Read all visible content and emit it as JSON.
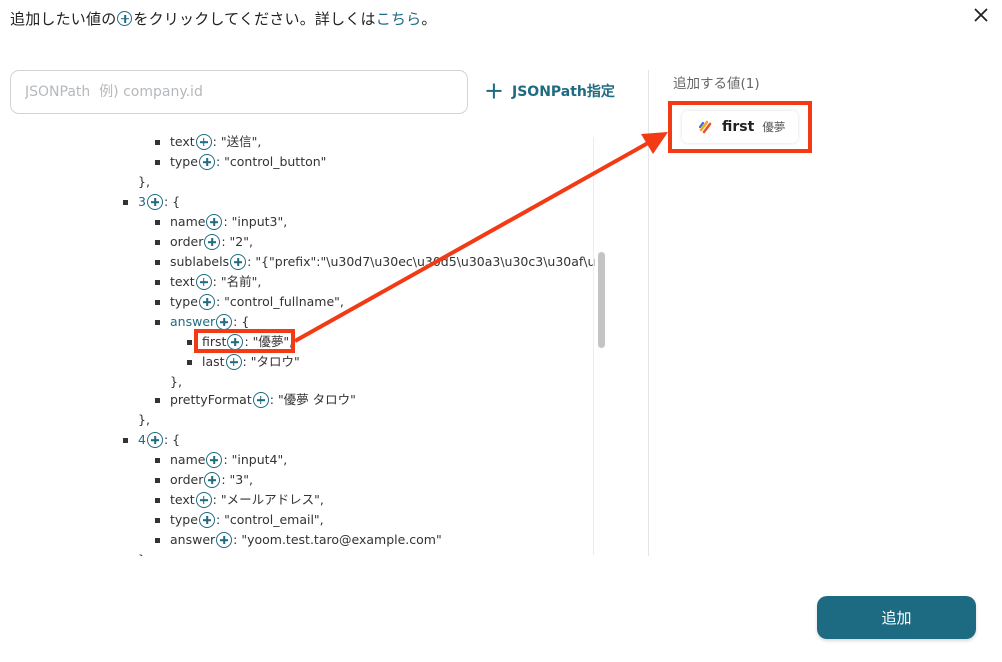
{
  "header": {
    "text_before": "追加したい値の",
    "text_after": "をクリックしてください。詳しくは",
    "link": "こちら",
    "period": "。"
  },
  "search": {
    "placeholder": "JSONPath  例) company.id",
    "value": ""
  },
  "jsonpath_button": {
    "label": "JSONPath指定"
  },
  "tree": [
    {
      "key": "text",
      "sep": ": ",
      "value": "\"送信\","
    },
    {
      "key": "type",
      "sep": ": ",
      "value": "\"control_button\""
    },
    {
      "key": "",
      "sep": "",
      "value": "},"
    },
    {
      "key": "3",
      "sep": ": ",
      "value": "{"
    },
    {
      "key": "name",
      "sep": ": ",
      "value": "\"input3\","
    },
    {
      "key": "order",
      "sep": ": ",
      "value": "\"2\","
    },
    {
      "key": "sublabels",
      "sep": ": ",
      "value": "\"{\"prefix\":\"\\u30d7\\u30ec\\u30d5\\u30a3\\u30c3\\u30af\\u"
    },
    {
      "key": "text",
      "sep": ": ",
      "value": "\"名前\","
    },
    {
      "key": "type",
      "sep": ": ",
      "value": "\"control_fullname\","
    },
    {
      "key": "answer",
      "sep": ": ",
      "value": "{"
    },
    {
      "key": "first",
      "sep": ": ",
      "value": "\"優夢\","
    },
    {
      "key": "last",
      "sep": ": ",
      "value": "\"タロウ\""
    },
    {
      "key": "",
      "sep": "",
      "value": "},"
    },
    {
      "key": "prettyFormat",
      "sep": ": ",
      "value": "\"優夢 タロウ\""
    },
    {
      "key": "",
      "sep": "",
      "value": "},"
    },
    {
      "key": "4",
      "sep": ": ",
      "value": "{"
    },
    {
      "key": "name",
      "sep": ": ",
      "value": "\"input4\","
    },
    {
      "key": "order",
      "sep": ": ",
      "value": "\"3\","
    },
    {
      "key": "text",
      "sep": ": ",
      "value": "\"メールアドレス\","
    },
    {
      "key": "type",
      "sep": ": ",
      "value": "\"control_email\","
    },
    {
      "key": "answer",
      "sep": ": ",
      "value": "\"yoom.test.taro@example.com\""
    },
    {
      "key": "",
      "sep": "",
      "value": "}"
    }
  ],
  "right_panel": {
    "title": "追加する値(1)",
    "values": [
      {
        "key": "first",
        "value": "優夢"
      }
    ]
  },
  "add_button": {
    "label": "追加"
  },
  "colors": {
    "accent": "#1e6b82",
    "highlight": "#f23a14",
    "button": "#1d6b82"
  }
}
